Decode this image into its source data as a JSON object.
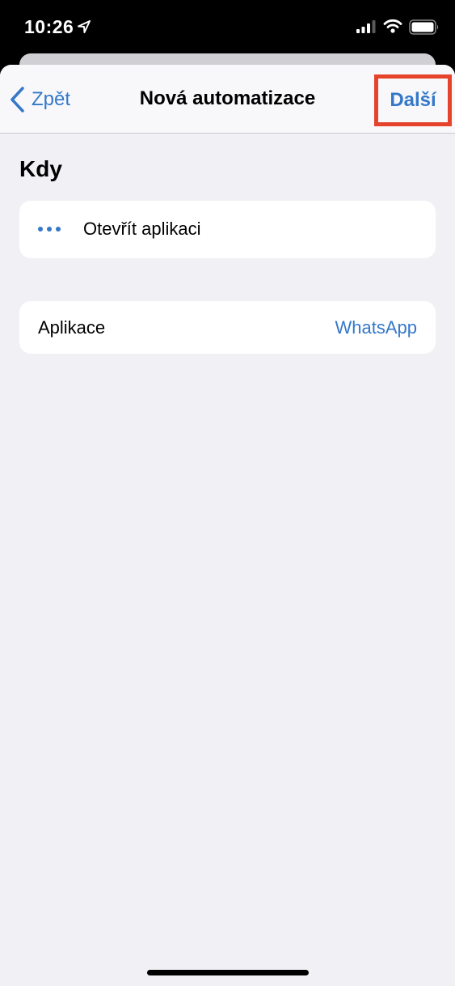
{
  "status_bar": {
    "time": "10:26",
    "icons": [
      "location-arrow-icon",
      "signal-icon",
      "wifi-icon",
      "battery-icon"
    ]
  },
  "nav": {
    "back_label": "Zpět",
    "title": "Nová automatizace",
    "next_label": "Další"
  },
  "section": {
    "title": "Kdy"
  },
  "trigger": {
    "label": "Otevřít aplikaci",
    "icon": "more-dots-icon"
  },
  "app_row": {
    "label": "Aplikace",
    "value": "WhatsApp"
  },
  "colors": {
    "accent": "#3478c9",
    "highlight": "#e5432b",
    "background": "#f1f0f5"
  }
}
